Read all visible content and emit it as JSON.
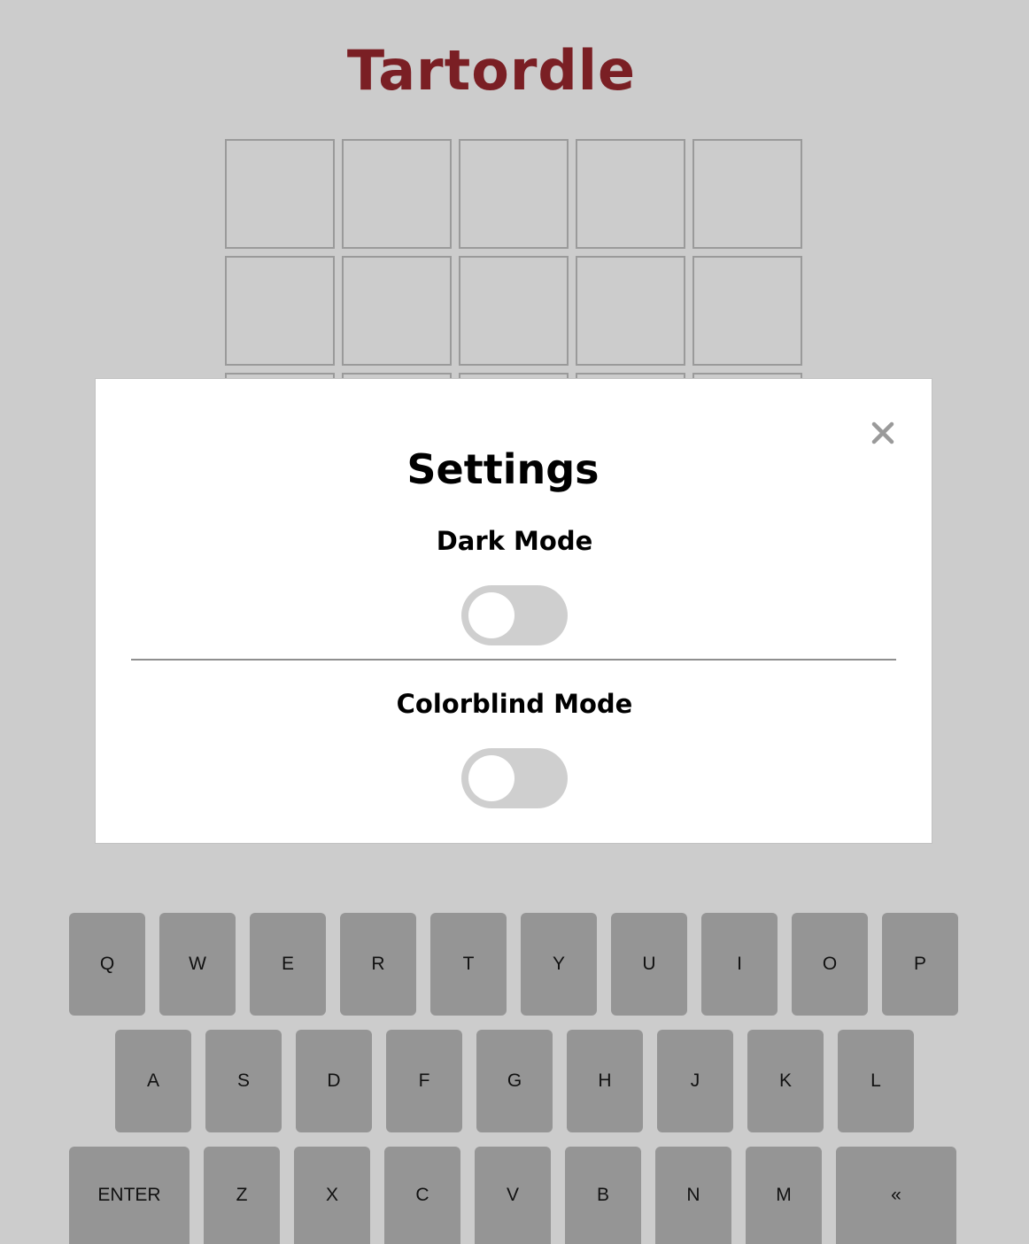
{
  "app": {
    "title": "Tartordle",
    "title_color": "#7a1f24",
    "background_color": "#cccccc"
  },
  "board": {
    "visible_rows": 3,
    "columns": 5
  },
  "settings_modal": {
    "title": "Settings",
    "close_icon": "close-icon",
    "close_glyph": "×",
    "options": [
      {
        "label": "Dark Mode",
        "enabled": false
      },
      {
        "label": "Colorblind Mode",
        "enabled": false
      }
    ]
  },
  "keyboard": {
    "key_color": "#959595",
    "rows": [
      [
        "Q",
        "W",
        "E",
        "R",
        "T",
        "Y",
        "U",
        "I",
        "O",
        "P"
      ],
      [
        "A",
        "S",
        "D",
        "F",
        "G",
        "H",
        "J",
        "K",
        "L"
      ],
      [
        "ENTER",
        "Z",
        "X",
        "C",
        "V",
        "B",
        "N",
        "M",
        "«"
      ]
    ]
  }
}
